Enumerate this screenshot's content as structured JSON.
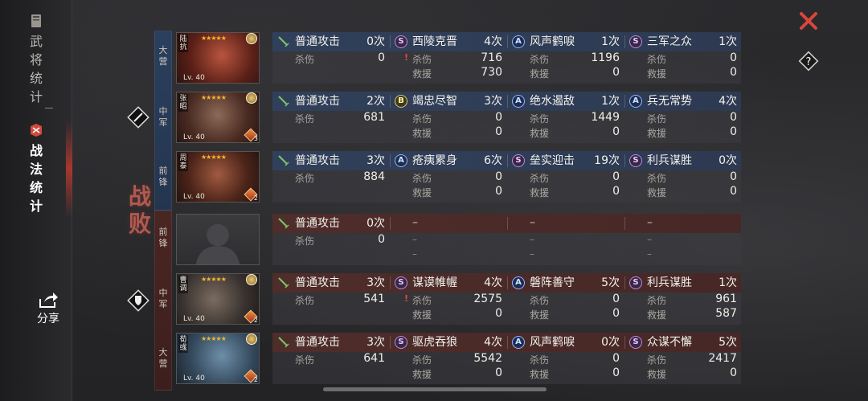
{
  "sidebar": {
    "tab_stats": "武将统计",
    "tab_tactics": "战法统计",
    "share": "分享"
  },
  "status": {
    "defeat": "战败"
  },
  "positions": {
    "blue": [
      "大营",
      "中军",
      "前锋"
    ],
    "red": [
      "前锋",
      "中军",
      "大营"
    ]
  },
  "generals": [
    {
      "name": "陆抗",
      "level": "Lv. 40",
      "troop": ""
    },
    {
      "name": "张昭",
      "level": "Lv. 40",
      "troop": "3"
    },
    {
      "name": "周泰",
      "level": "Lv. 40",
      "troop": "2"
    },
    {
      "name": "",
      "level": "",
      "troop": ""
    },
    {
      "name": "曹调",
      "level": "Lv. 40",
      "troop": "2"
    },
    {
      "name": "荀彧",
      "level": "Lv. 40",
      "troop": "2"
    }
  ],
  "labels": {
    "kill": "杀伤",
    "heal": "救援",
    "dash": "–"
  },
  "rows": [
    {
      "team": "blue",
      "cells": [
        {
          "icon": "sword-icon",
          "grade": "",
          "name": "普通攻击",
          "count": "0次",
          "kill": "0",
          "heal": ""
        },
        {
          "icon": "grade-s-icon",
          "grade": "S",
          "name": "西陵克晋",
          "count": "4次",
          "kill": "716",
          "heal": "730",
          "mark": "!"
        },
        {
          "icon": "grade-a-icon",
          "grade": "A",
          "name": "风声鹤唳",
          "count": "1次",
          "kill": "1196",
          "heal": "0"
        },
        {
          "icon": "grade-s-icon",
          "grade": "S",
          "name": "三军之众",
          "count": "1次",
          "kill": "0",
          "heal": "0"
        }
      ]
    },
    {
      "team": "blue",
      "cells": [
        {
          "icon": "sword-icon",
          "grade": "",
          "name": "普通攻击",
          "count": "2次",
          "kill": "681",
          "heal": ""
        },
        {
          "icon": "grade-b-icon",
          "grade": "B",
          "name": "竭忠尽智",
          "count": "3次",
          "kill": "0",
          "heal": "0"
        },
        {
          "icon": "grade-a-icon",
          "grade": "A",
          "name": "绝水遏敌",
          "count": "1次",
          "kill": "1449",
          "heal": "0"
        },
        {
          "icon": "grade-a-icon",
          "grade": "A",
          "name": "兵无常势",
          "count": "4次",
          "kill": "0",
          "heal": "0"
        }
      ]
    },
    {
      "team": "blue",
      "cells": [
        {
          "icon": "sword-icon",
          "grade": "",
          "name": "普通攻击",
          "count": "3次",
          "kill": "884",
          "heal": ""
        },
        {
          "icon": "grade-a-icon",
          "grade": "A",
          "name": "疮痍累身",
          "count": "6次",
          "kill": "0",
          "heal": "0"
        },
        {
          "icon": "grade-s-icon",
          "grade": "S",
          "name": "垒实迎击",
          "count": "19次",
          "kill": "0",
          "heal": "0"
        },
        {
          "icon": "grade-s-icon",
          "grade": "S",
          "name": "利兵谋胜",
          "count": "0次",
          "kill": "0",
          "heal": "0"
        }
      ]
    },
    {
      "team": "red",
      "cells": [
        {
          "icon": "sword-icon",
          "grade": "",
          "name": "普通攻击",
          "count": "0次",
          "kill": "0",
          "heal": ""
        },
        {
          "icon": "",
          "grade": "",
          "name": "–",
          "count": "",
          "kill": "–",
          "heal": "–",
          "empty": true
        },
        {
          "icon": "",
          "grade": "",
          "name": "–",
          "count": "",
          "kill": "–",
          "heal": "–",
          "empty": true
        },
        {
          "icon": "",
          "grade": "",
          "name": "–",
          "count": "",
          "kill": "–",
          "heal": "–",
          "empty": true
        }
      ]
    },
    {
      "team": "red",
      "cells": [
        {
          "icon": "sword-icon",
          "grade": "",
          "name": "普通攻击",
          "count": "3次",
          "kill": "541",
          "heal": ""
        },
        {
          "icon": "grade-s-icon",
          "grade": "S",
          "name": "谋谟帷幄",
          "count": "4次",
          "kill": "2575",
          "heal": "0",
          "mark": "!"
        },
        {
          "icon": "grade-a-icon",
          "grade": "A",
          "name": "磐阵善守",
          "count": "5次",
          "kill": "0",
          "heal": "0"
        },
        {
          "icon": "grade-s-icon",
          "grade": "S",
          "name": "利兵谋胜",
          "count": "1次",
          "kill": "961",
          "heal": "587"
        }
      ]
    },
    {
      "team": "red",
      "cells": [
        {
          "icon": "sword-icon",
          "grade": "",
          "name": "普通攻击",
          "count": "3次",
          "kill": "641",
          "heal": ""
        },
        {
          "icon": "grade-s-icon",
          "grade": "S",
          "name": "驱虎吞狼",
          "count": "4次",
          "kill": "5542",
          "heal": "0"
        },
        {
          "icon": "grade-a-icon",
          "grade": "A",
          "name": "风声鹤唳",
          "count": "0次",
          "kill": "0",
          "heal": "0"
        },
        {
          "icon": "grade-s-icon",
          "grade": "S",
          "name": "众谋不懈",
          "count": "5次",
          "kill": "2417",
          "heal": "0"
        }
      ]
    }
  ],
  "colors": {
    "accent_red": "#c63a2e",
    "blue_team": "#2b3f5e",
    "red_team": "#4a2623",
    "gold": "#f2b632"
  }
}
